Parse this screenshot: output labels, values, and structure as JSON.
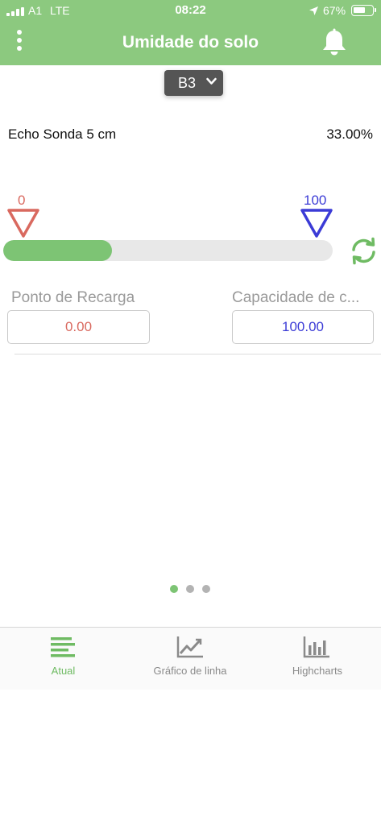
{
  "status_bar": {
    "carrier": "A1",
    "network": "LTE",
    "time": "08:22",
    "battery_percent": "67%",
    "battery_level": 0.67
  },
  "header": {
    "title": "Umidade do solo",
    "menu_icon": "more-vertical-icon",
    "bell_icon": "bell-icon"
  },
  "sensor_select": {
    "value": "B3",
    "icon": "chevron-down-icon"
  },
  "sensor": {
    "name": "Echo Sonda 5 cm",
    "value": "33.00%",
    "progress": 0.33
  },
  "markers": {
    "min_label": "0",
    "max_label": "100"
  },
  "fields": {
    "recarga_label": "Ponto de Recarga",
    "recarga_value": "0.00",
    "capacidade_label": "Capacidade de c...",
    "capacidade_value": "100.00"
  },
  "pager": {
    "count": 3,
    "active": 0
  },
  "tabs": [
    {
      "label": "Atual",
      "icon": "bars-list-icon",
      "active": true
    },
    {
      "label": "Gráfico de linha",
      "icon": "line-chart-icon",
      "active": false
    },
    {
      "label": "Highcharts",
      "icon": "bar-chart-icon",
      "active": false
    }
  ],
  "colors": {
    "header": "#8cc97f",
    "progress": "#7dc474",
    "min_marker": "#d9695f",
    "max_marker": "#3b3bd6"
  }
}
